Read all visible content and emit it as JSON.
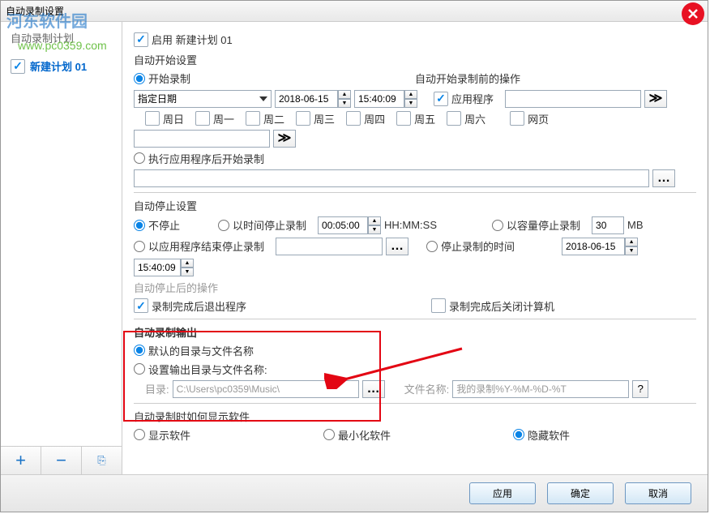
{
  "window": {
    "title": "自动录制设置"
  },
  "watermark": {
    "logo": "河东软件园",
    "url": "www.pc0359.com"
  },
  "sidebar": {
    "title": "自动录制计划",
    "items": [
      {
        "label": "新建计划 01"
      }
    ],
    "add_symbol": "+",
    "remove_symbol": "−",
    "paste_label": "⎘"
  },
  "enable": {
    "label": "启用 新建计划 01"
  },
  "auto_start": {
    "title": "自动开始设置",
    "start_recording": "开始录制",
    "specified_date": "指定日期",
    "date": "2018-06-15",
    "time": "15:40:09",
    "before_label": "自动开始录制前的操作",
    "app_label": "应用程序",
    "web_label": "网页",
    "execute_then_start": "执行应用程序后开始录制",
    "days": [
      "周日",
      "周一",
      "周二",
      "周三",
      "周四",
      "周五",
      "周六"
    ]
  },
  "auto_stop": {
    "title": "自动停止设置",
    "no_stop": "不停止",
    "by_time": "以时间停止录制",
    "time_value": "00:05:00",
    "time_unit": "HH:MM:SS",
    "by_size": "以容量停止录制",
    "size_value": "30",
    "size_unit": "MB",
    "by_app_end": "以应用程序结束停止录制",
    "stop_time_label": "停止录制的时间",
    "stop_date": "2018-06-15",
    "stop_time": "15:40:09",
    "after_title": "自动停止后的操作",
    "exit_after": "录制完成后退出程序",
    "shutdown_after": "录制完成后关闭计算机"
  },
  "output": {
    "title": "自动录制输出",
    "default_name": "默认的目录与文件名称",
    "custom_name": "设置输出目录与文件名称:",
    "dir_label": "目录:",
    "dir_value": "C:\\Users\\pc0359\\Music\\",
    "file_label": "文件名称:",
    "file_value": "我的录制%Y-%M-%D-%T"
  },
  "display": {
    "title": "自动录制时如何显示软件",
    "show": "显示软件",
    "minimize": "最小化软件",
    "hide": "隐藏软件"
  },
  "footer": {
    "apply": "应用",
    "ok": "确定",
    "cancel": "取消"
  }
}
